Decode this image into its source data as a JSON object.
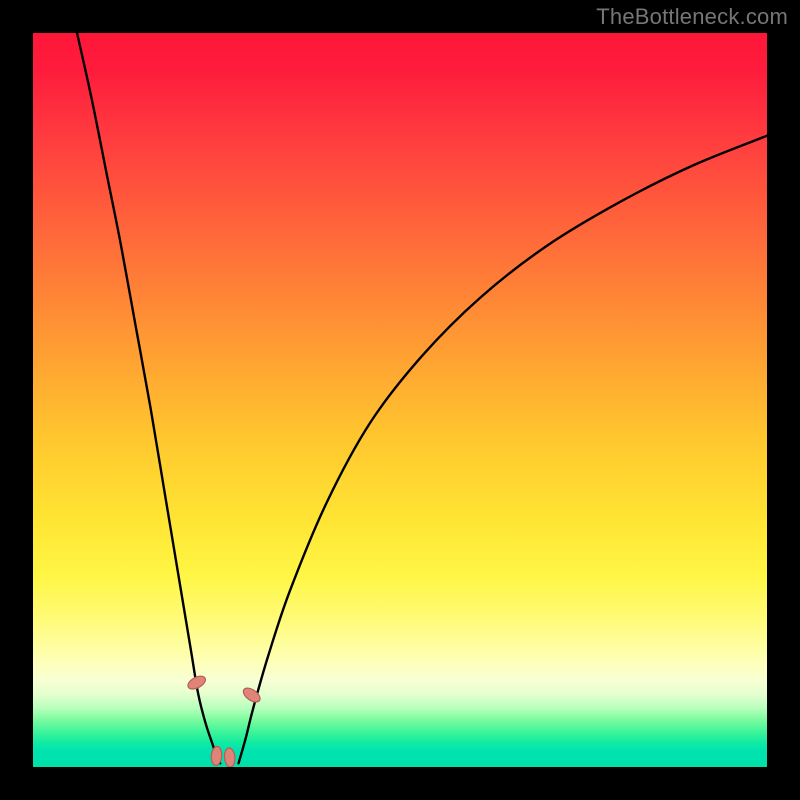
{
  "watermark": "TheBottleneck.com",
  "colors": {
    "background": "#000000",
    "curve_stroke": "#000000",
    "marker_fill": "#e08378",
    "marker_stroke": "#b35f55"
  },
  "chart_data": {
    "type": "line",
    "title": "",
    "xlabel": "",
    "ylabel": "",
    "xlim": [
      0,
      100
    ],
    "ylim": [
      0,
      100
    ],
    "grid": false,
    "gradient_stops": [
      {
        "pos": 0.0,
        "color": "#fe1638"
      },
      {
        "pos": 0.14,
        "color": "#ff3b3f"
      },
      {
        "pos": 0.28,
        "color": "#ff6a3a"
      },
      {
        "pos": 0.42,
        "color": "#ff9a33"
      },
      {
        "pos": 0.55,
        "color": "#ffc62e"
      },
      {
        "pos": 0.66,
        "color": "#ffe433"
      },
      {
        "pos": 0.8,
        "color": "#fffb79"
      },
      {
        "pos": 0.88,
        "color": "#f8ffd2"
      },
      {
        "pos": 0.92,
        "color": "#b7ffbc"
      },
      {
        "pos": 0.96,
        "color": "#16eca0"
      },
      {
        "pos": 1.0,
        "color": "#00e0a8"
      }
    ],
    "series": [
      {
        "name": "left-curve",
        "x": [
          6,
          8,
          10,
          12,
          14,
          16,
          18,
          20,
          21.5,
          22.5,
          23.5,
          24.5,
          25,
          25.5
        ],
        "y": [
          100,
          91,
          81,
          71,
          60,
          49,
          37,
          25,
          16,
          10,
          6,
          3,
          1.5,
          0.5
        ]
      },
      {
        "name": "right-curve",
        "x": [
          28,
          29,
          30,
          32,
          35,
          40,
          46,
          53,
          61,
          70,
          80,
          90,
          100
        ],
        "y": [
          0.5,
          4,
          8,
          15,
          24,
          36,
          47,
          56,
          64,
          71,
          77,
          82,
          86
        ]
      }
    ],
    "markers": [
      {
        "x": 22.3,
        "y": 11.5,
        "rot": 62
      },
      {
        "x": 25.0,
        "y": 1.5,
        "rot": 5
      },
      {
        "x": 26.8,
        "y": 1.3,
        "rot": -5
      },
      {
        "x": 29.8,
        "y": 9.8,
        "rot": -55
      }
    ],
    "marker_size": {
      "rx": 5.2,
      "ry": 9.5
    }
  }
}
